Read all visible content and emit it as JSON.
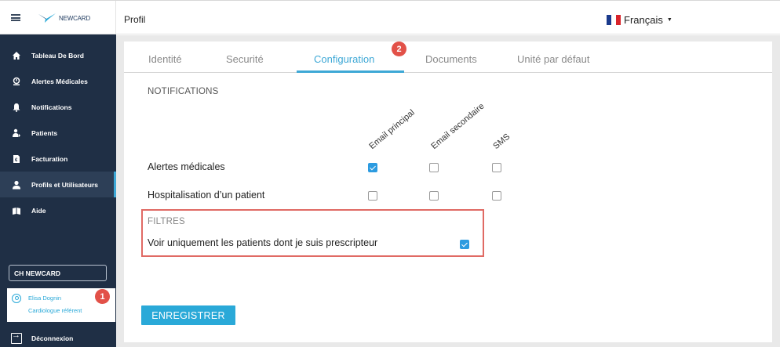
{
  "app": {
    "logo_text": "NEWCARD"
  },
  "header": {
    "title": "Profil",
    "language": "Français",
    "flag_colors": [
      "#1a3a8c",
      "#ffffff",
      "#d8232a"
    ]
  },
  "sidebar": {
    "items": [
      {
        "label": "Tableau De Bord",
        "icon": "home-icon"
      },
      {
        "label": "Alertes Médicales",
        "icon": "alert-icon"
      },
      {
        "label": "Notifications",
        "icon": "bell-icon"
      },
      {
        "label": "Patients",
        "icon": "patients-icon"
      },
      {
        "label": "Facturation",
        "icon": "invoice-icon"
      },
      {
        "label": "Profils et Utilisateurs",
        "icon": "user-icon",
        "active": true
      },
      {
        "label": "Aide",
        "icon": "help-icon"
      }
    ],
    "entity": "CH NEWCARD",
    "user": {
      "name": "Elisa Dognin",
      "role": "Cardiologue référent",
      "badge": "1"
    },
    "logout": "Déconnexion"
  },
  "tabs": [
    {
      "label": "Identité"
    },
    {
      "label": "Securité"
    },
    {
      "label": "Configuration",
      "active": true,
      "badge": "2"
    },
    {
      "label": "Documents"
    },
    {
      "label": "Unité par défaut"
    }
  ],
  "notifications": {
    "title": "NOTIFICATIONS",
    "columns": [
      "Email principal",
      "Email secondaire",
      "SMS"
    ],
    "rows": [
      {
        "label": "Alertes médicales",
        "values": [
          true,
          false,
          false
        ]
      },
      {
        "label": "Hospitalisation d’un patient",
        "values": [
          false,
          false,
          false
        ]
      }
    ]
  },
  "filters": {
    "title": "FILTRES",
    "label": "Voir uniquement les patients dont je suis prescripteur",
    "checked": true
  },
  "save_label": "ENREGISTRER",
  "colors": {
    "sidebar": "#1f2f45",
    "accent": "#3ea8d6",
    "badge": "#e25148",
    "highlight": "#e06a64"
  }
}
